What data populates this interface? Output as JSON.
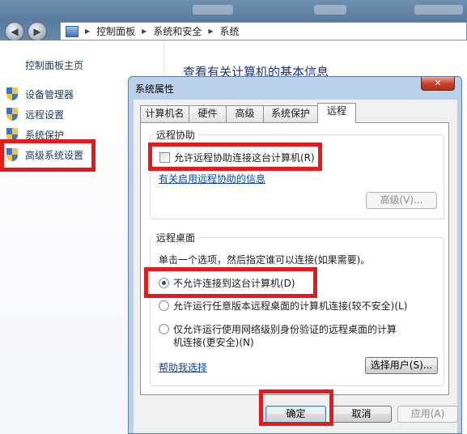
{
  "explorer": {
    "breadcrumb": [
      "控制面板",
      "系统和安全",
      "系统"
    ],
    "home_link": "控制面板主页",
    "side_links": [
      "设备管理器",
      "远程设置",
      "系统保护",
      "高级系统设置"
    ],
    "heading": "查看有关计算机的基本信息"
  },
  "dialog": {
    "title": "系统属性",
    "close_label": "✕",
    "tabs": [
      "计算机名",
      "硬件",
      "高级",
      "系统保护",
      "远程"
    ],
    "active_tab": "远程",
    "remote_assistance": {
      "group_label": "远程协助",
      "checkbox_label": "允许远程协助连接这台计算机(R)",
      "checked": false,
      "info_link": "有关启用远程协助的信息",
      "advanced_button": "高级(V)..."
    },
    "remote_desktop": {
      "group_label": "远程桌面",
      "instruction": "单击一个选项，然后指定谁可以连接(如果需要)。",
      "options": [
        "不允许连接到这台计算机(D)",
        "允许运行任意版本远程桌面的计算机连接(较不安全)(L)",
        "仅允许运行使用网络级别身份验证的远程桌面的计算",
        "机连接(更安全)(N)"
      ],
      "selected_index": 0,
      "help_link": "帮助我选择",
      "select_users_button": "选择用户(S)..."
    },
    "buttons": {
      "ok": "确定",
      "cancel": "取消",
      "apply": "应用(A)"
    }
  },
  "colors": {
    "highlight": "#e41a1c",
    "link": "#0a46b4",
    "titlebar": "#5a7c9f"
  }
}
